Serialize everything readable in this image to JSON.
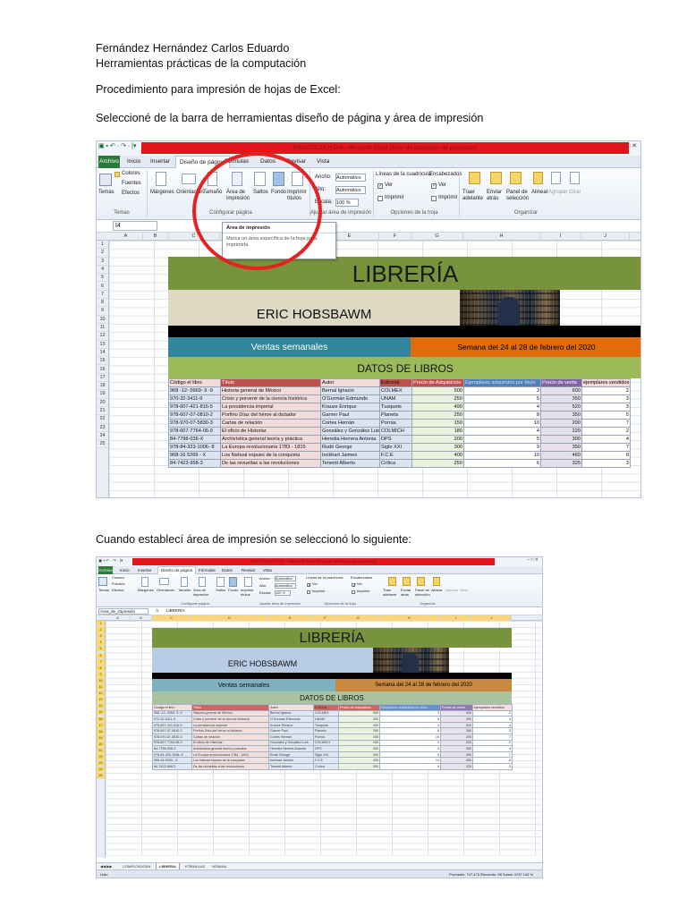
{
  "document": {
    "author": "Fernández Hernández Carlos Eduardo",
    "course": "Herramientas prácticas de la computación",
    "heading": "Procedimiento para impresión de hojas de Excel:",
    "step1": "Seleccioné de la barra de herramientas diseño de página y área de impresión",
    "step2": "Cuando establecí área de impresión se seleccionó lo siguiente:"
  },
  "excel": {
    "title_bar": "PRACTICAS HTAS - Microsoft Excel (Error de activación de productos)",
    "qat": "▣ ▪ ↶ · ↷ · |▾",
    "window_controls": "–  □  ✕",
    "ribbon_tabs": [
      "Archivo",
      "Inicio",
      "Insertar",
      "Diseño de página",
      "Fórmulas",
      "Datos",
      "Revisar",
      "Vista"
    ],
    "ribbon": {
      "temas": "Temas",
      "colores": "Colores",
      "fuentes": "Fuentes",
      "efectos": "Efectos",
      "margenes": "Márgenes",
      "orientacion": "Orientación",
      "tamano": "Tamaño",
      "area_impresion": "Área de impresión",
      "saltos": "Saltos",
      "fondo": "Fondo",
      "imprimir_titulos": "Imprimir títulos",
      "ancho": "Ancho:",
      "alto": "Alto:",
      "escala": "Escala:",
      "automatico": "Automático",
      "escala_valor": "100 %",
      "lineas_cuadricula": "Líneas de la cuadrícula",
      "encabezados": "Encabezados",
      "ver": "Ver",
      "imprimir": "Imprimir",
      "traer_adelante": "Traer adelante",
      "enviar_atras": "Enviar atrás",
      "panel_seleccion": "Panel de selección",
      "alinear": "Alinear",
      "agrupar": "Agrupar",
      "girar": "Girar",
      "group_temas": "Temas",
      "group_config": "Configurar página",
      "group_ajustar": "Ajustar área de impresión",
      "group_opciones": "Opciones de la hoja",
      "group_organizar": "Organizar"
    },
    "tooltip": {
      "title": "Área de impresión",
      "body": "Marca un área específica de la hoja para imprimirla."
    },
    "namebox_1": "I4",
    "namebox_2": "Área_de_impresión",
    "formula_2": "LIBRERÍA",
    "fx": "fx",
    "columns": [
      "A",
      "B",
      "C",
      "D",
      "E",
      "F",
      "G",
      "H",
      "I",
      "J"
    ],
    "rows": [
      "1",
      "2",
      "3",
      "4",
      "5",
      "6",
      "7",
      "8",
      "9",
      "10",
      "11",
      "12",
      "13",
      "14",
      "15",
      "16",
      "17",
      "18",
      "19",
      "20",
      "21",
      "22",
      "23",
      "24",
      "25"
    ],
    "sheet": {
      "title": "LIBRERÍA",
      "subtitle": "ERIC HOBSBAWM",
      "ventas": "Ventas semanales",
      "semana": "Semana del 24 al 28 de febrero del 2020",
      "datos": "DATOS DE LIBROS",
      "headers": [
        "Código el libro",
        "Título",
        "Autor",
        "Editorial",
        "Precio de Adquisición",
        "Ejemplares adquiridos por título",
        "Precio de venta",
        "ejemplares vendidos"
      ],
      "rows": [
        [
          "968 -12- 0969- 9 -9",
          "Historia general de México",
          "Bernal Ignacio",
          "COLMEX",
          "500",
          "3",
          "600",
          "2"
        ],
        [
          "970-32-3411-9",
          "Crisis y porvenir de la ciencia histórica",
          "O'Gormán Edmundo",
          "UNAM",
          "250",
          "5",
          "350",
          "3"
        ],
        [
          "978-607-421-816-5",
          "La presidencia imperial",
          "Krauze Enrique",
          "Tusquets",
          "490",
          "4",
          "520",
          "3"
        ],
        [
          "978-607-07-0810-2",
          "Porfirio Díaz del héroe al dictador",
          "Garner Paul",
          "Planeta",
          "250",
          "8",
          "350",
          "5"
        ],
        [
          "978-970-07-5830-3",
          "Cartas de relación",
          "Cortes Hernán",
          "Porrúa",
          "150",
          "10",
          "200",
          "7"
        ],
        [
          "978-607-7764-06-9",
          "El oficio de Historiar",
          "González y González Luis",
          "COLMICH",
          "180",
          "4",
          "220",
          "2"
        ],
        [
          "84-7798-036-X",
          "Archivística general teoría y práctica",
          "Heredia Herrera Antonia",
          "DPS",
          "200",
          "5",
          "300",
          "4"
        ],
        [
          "978-84-323-1006- 8",
          "La Europa revolucionaria 1783 - 1815",
          "Rudé George",
          "Siglo XXI",
          "300",
          "9",
          "350",
          "7"
        ],
        [
          "968-16 5269 - X",
          "Los Nahual espues de la conquista",
          "Iockhart Jaimes",
          "F.C.E",
          "400",
          "10",
          "460",
          "8"
        ],
        [
          "84-7423-958-3",
          "De las revueltas a las revoluciones",
          "Tenenti Alberto",
          "Crítica",
          "250",
          "6",
          "325",
          "3"
        ]
      ]
    },
    "sheet_tabs": [
      "COMPUTADORA",
      "LIBRERIA",
      "FÓRMULAS",
      "NÓMINA"
    ],
    "status_left": "Listo",
    "status_right": "Promedio: 747.475    Recuento: 98    Suma: 4797    100 %"
  },
  "colors": {
    "title_bar_red": "#e4151c",
    "file_tab_green": "#2c7a38",
    "banner_green": "#77933c",
    "banner_beige": "#ddd9c3",
    "ventas_blue": "#31859c",
    "semana_orange": "#e26b0a",
    "highlight_circle": "#e32222",
    "print_area_yellow": "#ffd966"
  }
}
